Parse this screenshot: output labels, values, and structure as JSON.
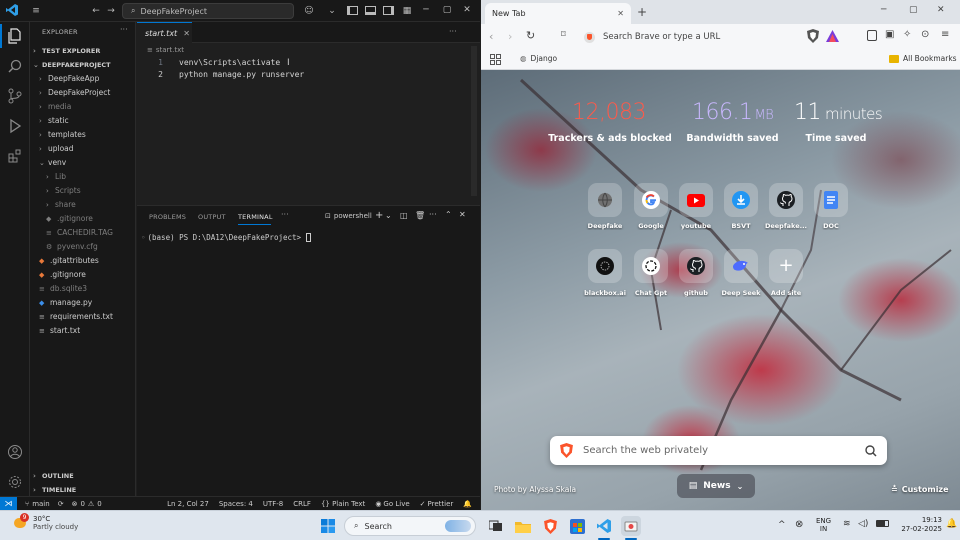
{
  "vscode": {
    "title_search": "DeepFakeProject",
    "sidebar": {
      "explorer_heading": "EXPLORER",
      "test_explorer": "TEST EXPLORER",
      "project": "DEEPFAKEPROJECT",
      "items": [
        {
          "label": "DeepFakeApp"
        },
        {
          "label": "DeepFakeProject"
        },
        {
          "label": "media"
        },
        {
          "label": "static"
        },
        {
          "label": "templates"
        },
        {
          "label": "upload"
        },
        {
          "label": "venv"
        },
        {
          "label": "Lib"
        },
        {
          "label": "Scripts"
        },
        {
          "label": "share"
        },
        {
          "label": ".gitignore"
        },
        {
          "label": "CACHEDIR.TAG"
        },
        {
          "label": "pyvenv.cfg"
        },
        {
          "label": ".gitattributes"
        },
        {
          "label": ".gitignore"
        },
        {
          "label": "db.sqlite3"
        },
        {
          "label": "manage.py"
        },
        {
          "label": "requirements.txt"
        },
        {
          "label": "start.txt"
        }
      ],
      "outline": "OUTLINE",
      "timeline": "TIMELINE"
    },
    "editor": {
      "tab_label": "start.txt",
      "breadcrumb": "start.txt",
      "lines": [
        {
          "num": "1",
          "text": "venv\\Scripts\\activate"
        },
        {
          "num": "2",
          "text": "python manage.py runserver"
        }
      ]
    },
    "panel": {
      "tabs": [
        "PROBLEMS",
        "OUTPUT",
        "TERMINAL"
      ],
      "more": "···",
      "shell": "powershell",
      "prompt": "(base) PS D:\\DA12\\DeepFakeProject> "
    },
    "status": {
      "branch": "main",
      "errors": "0",
      "warnings": "0",
      "position": "Ln 2, Col 27",
      "spaces": "Spaces: 4",
      "encoding": "UTF-8",
      "eol": "CRLF",
      "language": "{} Plain Text",
      "go_live": "Go Live",
      "prettier": "Prettier"
    }
  },
  "brave": {
    "tab_title": "New Tab",
    "omnibox_placeholder": "Search Brave or type a URL",
    "bookmark": "Django",
    "all_bookmarks": "All Bookmarks",
    "stats": [
      {
        "value": "12,083",
        "unit": "",
        "label": "Trackers & ads blocked",
        "color": "#ff5a4a"
      },
      {
        "value": "166.1",
        "unit": "MB",
        "label": "Bandwidth saved",
        "color": "#c9b8ff"
      },
      {
        "value": "11",
        "unit": "minutes",
        "label": "Time saved",
        "color": "#ffffff"
      }
    ],
    "tiles_row1": [
      {
        "label": "Deepfake",
        "icon": "globe-icon"
      },
      {
        "label": "Google",
        "icon": "google-icon"
      },
      {
        "label": "youtube",
        "icon": "youtube-icon"
      },
      {
        "label": "BSVT",
        "icon": "download-icon"
      },
      {
        "label": "Deepfake...",
        "icon": "github-icon"
      },
      {
        "label": "DOC",
        "icon": "docs-icon"
      }
    ],
    "tiles_row2": [
      {
        "label": "blackbox.ai",
        "icon": "blackbox-icon"
      },
      {
        "label": "Chat Gpt",
        "icon": "openai-icon"
      },
      {
        "label": "github",
        "icon": "github-icon"
      },
      {
        "label": "Deep Seek",
        "icon": "deepseek-icon"
      },
      {
        "label": "Add site",
        "icon": "plus-icon"
      }
    ],
    "search_placeholder": "Search the web privately",
    "photo_credit": "Photo by Alyssa Skala",
    "news": "News",
    "customize": "Customize"
  },
  "taskbar": {
    "weather_temp": "30°C",
    "weather_desc": "Partly cloudy",
    "search": "Search",
    "lang_top": "ENG",
    "lang_bottom": "IN",
    "time": "19:13",
    "date": "27-02-2025",
    "notif_badge": "9"
  }
}
